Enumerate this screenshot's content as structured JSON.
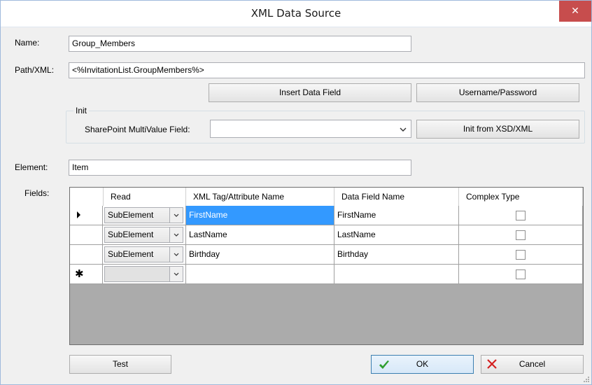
{
  "window": {
    "title": "XML Data Source",
    "close_label": "✕"
  },
  "form": {
    "name_label": "Name:",
    "name_value": "Group_Members",
    "path_label": "Path/XML:",
    "path_value": "<%InvitationList.GroupMembers%>",
    "insert_button": "Insert Data Field",
    "userpass_button": "Username/Password",
    "init_legend": "Init",
    "sp_label": "SharePoint MultiValue Field:",
    "sp_value": "",
    "init_button": "Init from XSD/XML",
    "element_label": "Element:",
    "element_value": "Item",
    "fields_label": "Fields:"
  },
  "grid": {
    "columns": [
      "Read",
      "XML Tag/Attribute Name",
      "Data Field Name",
      "Complex Type"
    ],
    "rows": [
      {
        "read": "SubElement",
        "xml_tag": "FirstName",
        "data_field": "FirstName",
        "complex": false,
        "current": true
      },
      {
        "read": "SubElement",
        "xml_tag": "LastName",
        "data_field": "LastName",
        "complex": false,
        "current": false
      },
      {
        "read": "SubElement",
        "xml_tag": "Birthday",
        "data_field": "Birthday",
        "complex": false,
        "current": false
      }
    ],
    "new_row_marker": "✱"
  },
  "footer": {
    "test_button": "Test",
    "ok_button": "OK",
    "cancel_button": "Cancel"
  },
  "colors": {
    "selection": "#3399ff",
    "close": "#c74d4d",
    "ok_check": "#2e9e2e",
    "cancel_x": "#d42020"
  }
}
